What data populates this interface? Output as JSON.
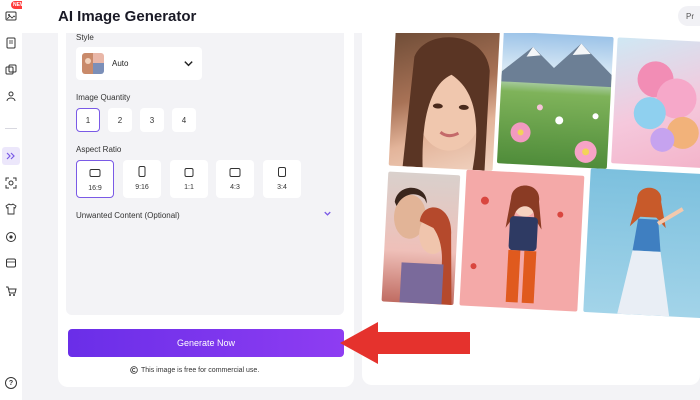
{
  "app": {
    "title": "AI Image Generator",
    "pro_label": "Pr"
  },
  "rail": {
    "new_badge": "NEW",
    "help_glyph": "?"
  },
  "style": {
    "label": "Style",
    "value": "Auto"
  },
  "quantity": {
    "label": "Image Quantity",
    "options": [
      "1",
      "2",
      "3",
      "4"
    ],
    "selected": "1"
  },
  "aspect": {
    "label": "Aspect Ratio",
    "options": [
      "16:9",
      "9:16",
      "1:1",
      "4:3",
      "3:4"
    ],
    "selected": "16:9"
  },
  "unwanted": {
    "label": "Unwanted Content (Optional)"
  },
  "generate": {
    "label": "Generate Now",
    "note": "This image is free for commercial use."
  },
  "colors": {
    "accent": "#7a5ae6",
    "button_start": "#6a2ee8",
    "button_end": "#8e3df2",
    "arrow": "#e5322d"
  },
  "icons": [
    "image-icon",
    "document-icon",
    "layers-icon",
    "person-cut-icon",
    "sparkle-icon",
    "face-swap-icon",
    "shirt-icon",
    "eye-icon",
    "frame-icon",
    "cart-icon",
    "help-icon",
    "chevron-down-icon",
    "copyright-icon"
  ]
}
